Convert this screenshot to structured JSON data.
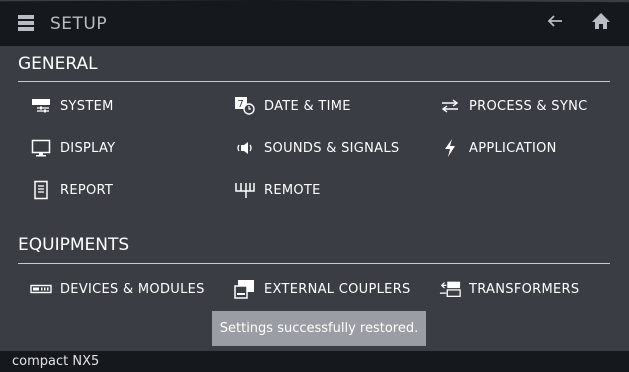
{
  "header": {
    "title": "SETUP"
  },
  "general": {
    "title": "GENERAL",
    "items": [
      {
        "label": "SYSTEM",
        "icon": "system-icon"
      },
      {
        "label": "DATE & TIME",
        "icon": "date-time-icon"
      },
      {
        "label": "PROCESS & SYNC",
        "icon": "process-sync-icon"
      },
      {
        "label": "DISPLAY",
        "icon": "display-icon"
      },
      {
        "label": "SOUNDS & SIGNALS",
        "icon": "speaker-icon"
      },
      {
        "label": "APPLICATION",
        "icon": "lightning-icon"
      },
      {
        "label": "REPORT",
        "icon": "report-icon"
      },
      {
        "label": "REMOTE",
        "icon": "remote-icon"
      }
    ]
  },
  "equipments": {
    "title": "EQUIPMENTS",
    "items": [
      {
        "label": "DEVICES & MODULES",
        "icon": "devices-icon"
      },
      {
        "label": "EXTERNAL COUPLERS",
        "icon": "couplers-icon"
      },
      {
        "label": "TRANSFORMERS",
        "icon": "transformers-icon"
      }
    ]
  },
  "toast": {
    "message": "Settings successfully restored."
  },
  "footer": {
    "device": "compact NX5"
  },
  "colors": {
    "background": "#3a3d44",
    "bar": "#15181d",
    "toast": "#9a9ea4"
  }
}
